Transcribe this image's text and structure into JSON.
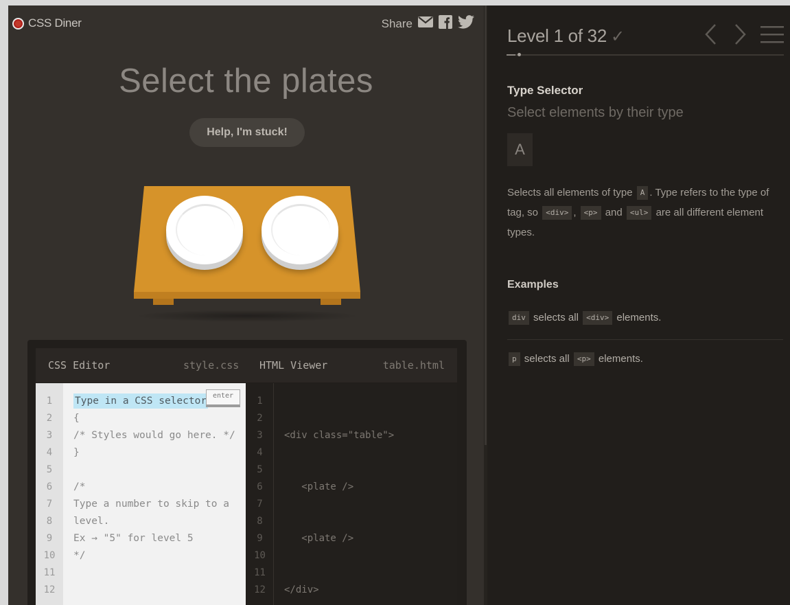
{
  "app": {
    "name": "CSS Diner"
  },
  "share": {
    "label": "Share"
  },
  "level": {
    "title": "Select the plates",
    "help_label": "Help, I'm stuck!",
    "counter": "Level 1 of 32",
    "check": "✓",
    "current": 1,
    "total": 32
  },
  "editor": {
    "css_title": "CSS Editor",
    "css_file": "style.css",
    "html_title": "HTML Viewer",
    "html_file": "table.html",
    "enter_label": "enter",
    "css_input_placeholder": "Type in a CSS selector",
    "css_lines": [
      "{",
      "/* Styles would go here. */",
      "}",
      "",
      "/*",
      "Type a number to skip to a",
      "level.",
      "Ex → \"5\" for level 5",
      "*/"
    ],
    "html_lines": [
      "<div class=\"table\">",
      "   <plate />",
      "   <plate />",
      "</div>"
    ],
    "line_numbers": [
      "1",
      "2",
      "3",
      "4",
      "5",
      "6",
      "7",
      "8",
      "9",
      "10",
      "11",
      "12"
    ]
  },
  "sidebar": {
    "selector_name": "Type Selector",
    "selector_desc": "Select elements by their type",
    "syntax": "A",
    "desc_parts": {
      "p1": "Selects all elements of type ",
      "t1": "A",
      "p2": ". Type refers to the type of tag, so ",
      "t2": "<div>",
      "p3": ", ",
      "t3": "<p>",
      "p4": " and ",
      "t4": "<ul>",
      "p5": " are all different element types."
    },
    "examples_title": "Examples",
    "examples": [
      {
        "code": "div",
        "text1": " selects all ",
        "tag": "<div>",
        "text2": " elements."
      },
      {
        "code": "p",
        "text1": " selects all ",
        "tag": "<p>",
        "text2": " elements."
      }
    ]
  },
  "colors": {
    "table": "#d6932a",
    "plate": "#ffffff",
    "highlight": "#bfe6f5",
    "brand_dot": "#c0392b"
  },
  "icons": [
    "mail-icon",
    "facebook-icon",
    "twitter-icon",
    "chevron-left-icon",
    "chevron-right-icon",
    "menu-icon",
    "checkmark-icon"
  ]
}
